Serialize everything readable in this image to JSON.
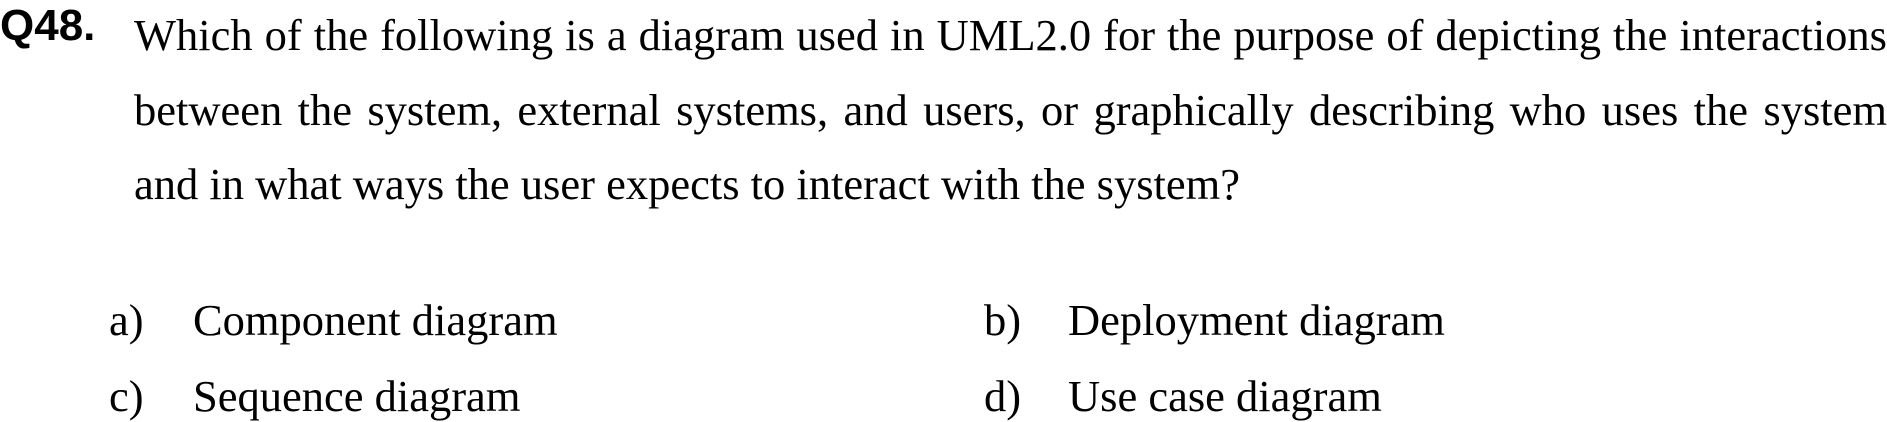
{
  "question": {
    "number": "Q48.",
    "text": "Which of the following is a diagram used in UML2.0 for the purpose of depicting the interactions between the system, external systems, and users, or graphically describing who uses the system and in what ways the user expects to interact with the system?"
  },
  "options": [
    {
      "letter": "a)",
      "label": "Component diagram"
    },
    {
      "letter": "b)",
      "label": "Deployment diagram"
    },
    {
      "letter": "c)",
      "label": "Sequence diagram"
    },
    {
      "letter": "d)",
      "label": "Use case diagram"
    }
  ]
}
